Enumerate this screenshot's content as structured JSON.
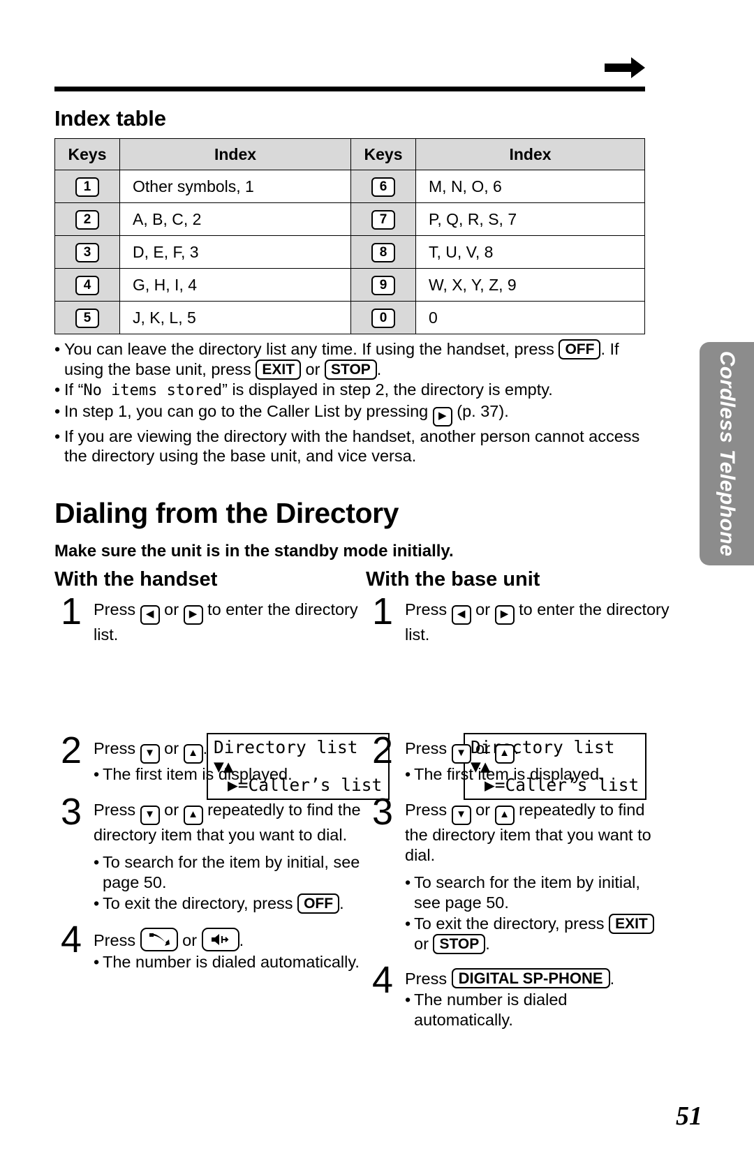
{
  "page": {
    "number": "51",
    "side_tab_label": "Cordless Telephone",
    "top_arrow_icon": "right-arrow-icon"
  },
  "index_section": {
    "heading": "Index table",
    "headers": [
      "Keys",
      "Index",
      "Keys",
      "Index"
    ],
    "rows": [
      {
        "key_left": "1",
        "index_left": "Other symbols, 1",
        "key_right": "6",
        "index_right": "M, N, O, 6"
      },
      {
        "key_left": "2",
        "index_left": "A, B, C, 2",
        "key_right": "7",
        "index_right": "P, Q, R, S, 7"
      },
      {
        "key_left": "3",
        "index_left": "D, E, F, 3",
        "key_right": "8",
        "index_right": "T, U, V, 8"
      },
      {
        "key_left": "4",
        "index_left": "G, H, I, 4",
        "key_right": "9",
        "index_right": "W, X, Y, Z, 9"
      },
      {
        "key_left": "5",
        "index_left": "J, K, L, 5",
        "key_right": "0",
        "index_right": "0"
      }
    ]
  },
  "notes": {
    "bullet": "•",
    "items": [
      {
        "part1": "You can leave the directory list any time. If using the handset, press ",
        "btn1": "OFF",
        "part2": ". If using the base unit, press ",
        "btn2": "EXIT",
        "part3": " or ",
        "btn3": "STOP",
        "part4": "."
      },
      {
        "part1": "If “",
        "mono": "No items stored",
        "part2": "” is displayed in step 2, the directory is empty."
      },
      {
        "part1": "In step 1, you can go to the Caller List by pressing ",
        "key": "▶",
        "part2": " (p. 37)."
      },
      {
        "part1": "If you are viewing the directory with the handset, another person cannot access the directory using the base unit, and vice versa."
      }
    ]
  },
  "dialing_section": {
    "heading": "Dialing from the Directory",
    "subheading": "Make sure the unit is in the standby mode initially."
  },
  "handset_column": {
    "heading": "With the handset",
    "steps": [
      {
        "num": "1",
        "text1": "Press ",
        "key1": "◀",
        "text2": " or ",
        "key2": "▶",
        "text3": " to enter the directory list."
      },
      {
        "num": "2",
        "text1": "Press ",
        "key1": "▼",
        "text2": " or ",
        "key2": "▲",
        "text3": ".",
        "sub": [
          "The first item is displayed."
        ]
      },
      {
        "num": "3",
        "text1": "Press ",
        "key1": "▼",
        "text2": " or ",
        "key2": "▲",
        "text3": " repeatedly to find the directory item that you want to dial.",
        "sub_a": "To search for the item by initial, see page 50.",
        "sub_b_pre": "To exit the directory, press ",
        "sub_b_btn1": "OFF",
        "sub_b_post": "."
      },
      {
        "num": "4",
        "text1": "Press ",
        "icon1": "talk-handset-icon",
        "text2": " or ",
        "icon2": "speakerphone-icon",
        "text3": ".",
        "sub": [
          "The number is dialed automatically."
        ]
      }
    ],
    "lcd": {
      "line1": "Directory list",
      "line2": "▼▲",
      "line3": "▶=Caller’s list"
    }
  },
  "base_unit_column": {
    "heading": "With the base unit",
    "steps": [
      {
        "num": "1",
        "text1": "Press ",
        "key1": "◀",
        "text2": " or ",
        "key2": "▶",
        "text3": " to enter the directory list."
      },
      {
        "num": "2",
        "text1": "Press ",
        "key1": "▼",
        "text2": " or ",
        "key2": "▲",
        "text3": ".",
        "sub": [
          "The first item is displayed."
        ]
      },
      {
        "num": "3",
        "text1": "Press ",
        "key1": "▼",
        "text2": " or ",
        "key2": "▲",
        "text3": " repeatedly to find the directory item that you want to dial.",
        "sub_a": "To search for the item by initial, see page 50.",
        "sub_b_pre": "To exit the directory, press ",
        "sub_b_btn1": "EXIT",
        "sub_b_mid": " or ",
        "sub_b_btn2": "STOP",
        "sub_b_post": "."
      },
      {
        "num": "4",
        "text1": "Press ",
        "btn1": "DIGITAL SP-PHONE",
        "text3": ".",
        "sub": [
          "The number is dialed automatically."
        ]
      }
    ],
    "lcd": {
      "line1": "Directory list",
      "line2": "▼▲",
      "line3": "▶=Caller’s list"
    }
  }
}
